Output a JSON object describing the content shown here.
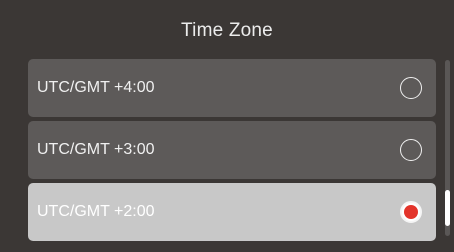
{
  "header": {
    "title": "Time Zone"
  },
  "timezones": {
    "items": [
      {
        "label": "UTC/GMT +4:00",
        "selected": false
      },
      {
        "label": "UTC/GMT +3:00",
        "selected": false
      },
      {
        "label": "UTC/GMT +2:00",
        "selected": true
      }
    ]
  },
  "colors": {
    "background": "#3b3735",
    "row": "#5d5a59",
    "row_selected": "#c8c8c8",
    "radio_selected": "#e3342b",
    "text": "#f0f0f0"
  },
  "icons": {
    "radio_unchecked": "radio-unchecked-icon",
    "radio_checked": "radio-checked-icon"
  }
}
